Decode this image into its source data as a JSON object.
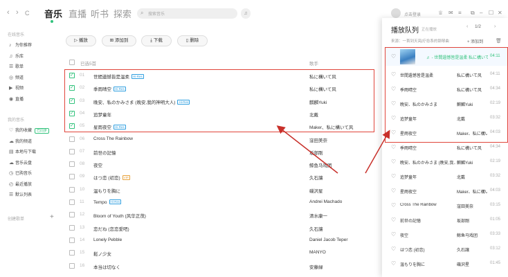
{
  "nav": {
    "back": "‹",
    "forward": "›",
    "refresh": "C"
  },
  "tabs": [
    "音乐",
    "直播",
    "听书",
    "探索"
  ],
  "search": {
    "placeholder": "搜索音乐"
  },
  "user": {
    "login": "点击登录"
  },
  "sidebar": {
    "online_head": "在线音乐",
    "online": [
      {
        "icon": "♪",
        "label": "为你推荐"
      },
      {
        "icon": "♫",
        "label": "乐库"
      },
      {
        "icon": "☰",
        "label": "歌单"
      },
      {
        "icon": "◎",
        "label": "频道"
      },
      {
        "icon": "▶",
        "label": "视频"
      },
      {
        "icon": "◉",
        "label": "直播"
      }
    ],
    "mine_head": "我的音乐",
    "mine": [
      {
        "icon": "♡",
        "label": "我的收藏",
        "badge": "已同步"
      },
      {
        "icon": "☁",
        "label": "我的频道"
      },
      {
        "icon": "▤",
        "label": "本地与下载"
      },
      {
        "icon": "☁",
        "label": "音乐云盘"
      },
      {
        "icon": "◷",
        "label": "已购音乐"
      },
      {
        "icon": "◴",
        "label": "最近播放"
      },
      {
        "icon": "☰",
        "label": "默认列表"
      }
    ],
    "create_label": "创建歌单",
    "create_plus": "+"
  },
  "toolbar": {
    "play": "播放",
    "add": "添加到",
    "download": "下载",
    "delete": "删除"
  },
  "list_header": {
    "selected": "已选5首",
    "artist": "歌手"
  },
  "songs": [
    {
      "num": "01",
      "title": "世間遺憾皆是温柔",
      "tag": "Hi-Res",
      "artist": "私に構いて风",
      "checked": true
    },
    {
      "num": "02",
      "title": "季雨晴空",
      "tag": "Hi-Res",
      "artist": "私に構いて风",
      "checked": true
    },
    {
      "num": "03",
      "title": "晚安、私のかみさま (晚安,我的神明大人)",
      "tag": "Hi-Res",
      "artist": "麒麟Yuki",
      "checked": true
    },
    {
      "num": "04",
      "title": "追梦童年",
      "tag": "",
      "artist": "北戴",
      "checked": true
    },
    {
      "num": "05",
      "title": "星雨夜空",
      "tag": "Hi-Res",
      "artist": "Maker、私に構いて风",
      "checked": true
    },
    {
      "num": "06",
      "title": "Cross The Rainbow",
      "tag": "",
      "artist": "窪田美奈",
      "checked": false
    },
    {
      "num": "07",
      "title": "前世の記憶",
      "tag": "",
      "artist": "坂部剛",
      "checked": false
    },
    {
      "num": "08",
      "title": "夜空",
      "tag": "",
      "artist": "鲸鱼马戏团",
      "checked": false
    },
    {
      "num": "09",
      "title": "はつ恋 (初恋)",
      "tag": "VIP",
      "artist": "久石讓",
      "checked": false
    },
    {
      "num": "10",
      "title": "温もりを胸に",
      "tag": "",
      "artist": "磯沢星",
      "checked": false
    },
    {
      "num": "11",
      "title": "Tempo",
      "tag": "Hi-Res",
      "artist": "Andrei Machado",
      "checked": false
    },
    {
      "num": "12",
      "title": "Bloom of Youth (风华正茂)",
      "tag": "",
      "artist": "清水康一",
      "checked": false
    },
    {
      "num": "13",
      "title": "恋だね (恋恋爱吧)",
      "tag": "",
      "artist": "久石讓",
      "checked": false
    },
    {
      "num": "14",
      "title": "Lonely Pebble",
      "tag": "",
      "artist": "Daniel Jacob Teper",
      "checked": false
    },
    {
      "num": "15",
      "title": "鬆ノ少女",
      "tag": "",
      "artist": "MANYO",
      "checked": false
    },
    {
      "num": "16",
      "title": "本当は切なく",
      "tag": "",
      "artist": "安藤緑",
      "checked": false
    }
  ],
  "queue": {
    "title": "播放队列",
    "subtitle": "正在播放",
    "page": "1/2",
    "bar": "来源：一首到天亮|疗愈系的钢琴曲",
    "add": "添加到",
    "delete": "🗑",
    "playing": {
      "title": "♬ - 世間遺憾皆是温柔",
      "artist": "私に構いて风",
      "time": "04:11"
    },
    "items": [
      {
        "title": "世間遺憾皆是温柔",
        "artist": "私に構いて风",
        "time": "04:11"
      },
      {
        "title": "季雨晴空",
        "artist": "私に構いて风",
        "time": "04:34"
      },
      {
        "title": "晚安、私のかみさま",
        "artist": "麒麟Yuki",
        "time": "02:19"
      },
      {
        "title": "追梦童年",
        "artist": "北戴",
        "time": "03:32"
      },
      {
        "title": "星雨夜空",
        "artist": "Maker、私に構いて风",
        "time": "04:03"
      },
      {
        "title": "季雨晴空",
        "artist": "私に構いて风",
        "time": "04:34"
      },
      {
        "title": "晚安、私のかみさま (晚安,我...",
        "artist": "麒麟Yuki",
        "time": "02:19"
      },
      {
        "title": "追梦童年",
        "artist": "北戴",
        "time": "03:32"
      },
      {
        "title": "星雨夜空",
        "artist": "Maker、私に構いて风",
        "time": "04:03"
      },
      {
        "title": "Cross The Rainbow",
        "artist": "窪田美奈",
        "time": "03:15"
      },
      {
        "title": "前世の記憶",
        "artist": "坂部剛",
        "time": "01:05"
      },
      {
        "title": "夜空",
        "artist": "鲸鱼马戏团",
        "time": "03:33"
      },
      {
        "title": "はつ恋 (初恋)",
        "artist": "久石讓",
        "time": "03:12"
      },
      {
        "title": "温もりを胸に",
        "artist": "磯沢星",
        "time": "01:45"
      }
    ]
  }
}
